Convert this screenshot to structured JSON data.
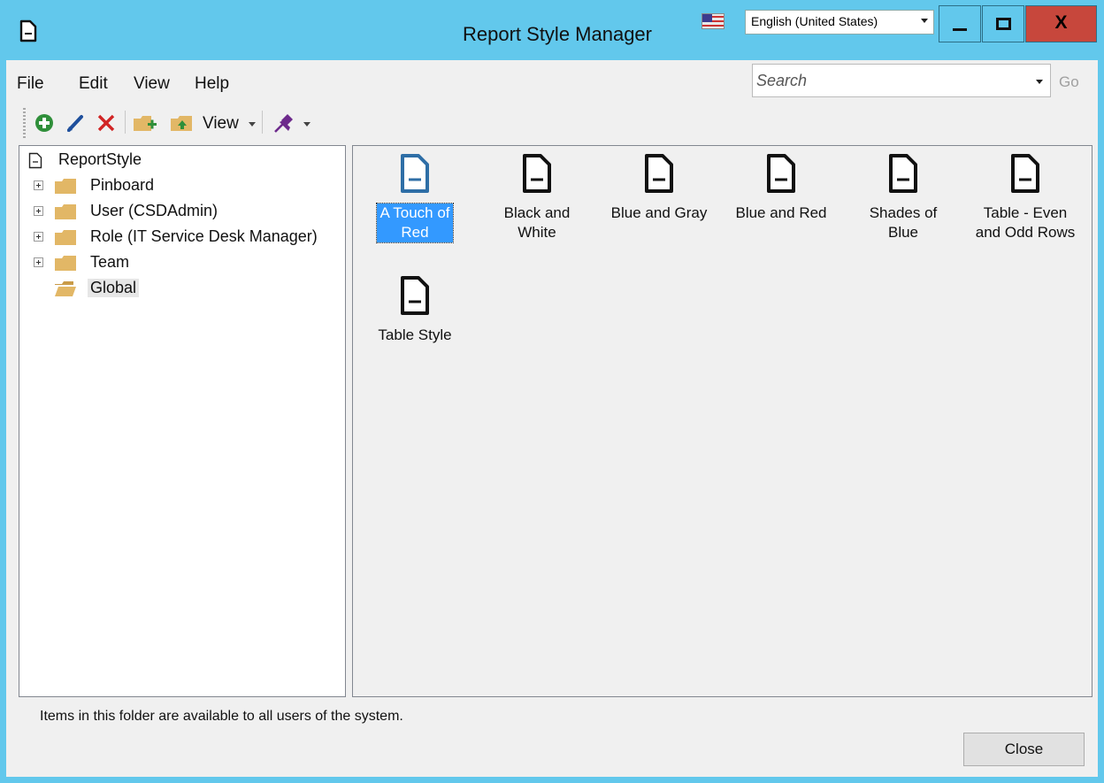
{
  "window": {
    "title": "Report Style Manager",
    "language": "English (United States)",
    "close_glyph": "X"
  },
  "menu": {
    "items": [
      "File",
      "Edit",
      "View",
      "Help"
    ]
  },
  "search": {
    "placeholder": "Search",
    "value": "",
    "go_label": "Go"
  },
  "toolbar": {
    "view_label": "View",
    "icons": [
      "add-icon",
      "edit-icon",
      "delete-icon",
      "new-folder-icon",
      "up-folder-icon",
      "pin-icon"
    ]
  },
  "tree": {
    "root": "ReportStyle",
    "nodes": [
      {
        "label": "Pinboard",
        "expandable": true
      },
      {
        "label": "User (CSDAdmin)",
        "expandable": true
      },
      {
        "label": "Role (IT Service Desk Manager)",
        "expandable": true
      },
      {
        "label": "Team",
        "expandable": true
      },
      {
        "label": "Global",
        "expandable": false,
        "selected": true
      }
    ]
  },
  "items": [
    {
      "line1": "A Touch of",
      "line2": "Red",
      "selected": true
    },
    {
      "line1": "Black and",
      "line2": "White",
      "selected": false
    },
    {
      "line1": "Blue and Gray",
      "line2": "",
      "selected": false
    },
    {
      "line1": "Blue and Red",
      "line2": "",
      "selected": false
    },
    {
      "line1": "Shades of",
      "line2": "Blue",
      "selected": false
    },
    {
      "line1": "Table - Even",
      "line2": "and Odd Rows",
      "selected": false
    },
    {
      "line1": "Table Style",
      "line2": "",
      "selected": false
    }
  ],
  "status": "Items in this folder are available to all users of the system.",
  "buttons": {
    "close": "Close"
  },
  "colors": {
    "titlebar": "#62c8ec",
    "close_button": "#c7473c",
    "selection": "#3399ff",
    "folder": "#e2b766"
  }
}
